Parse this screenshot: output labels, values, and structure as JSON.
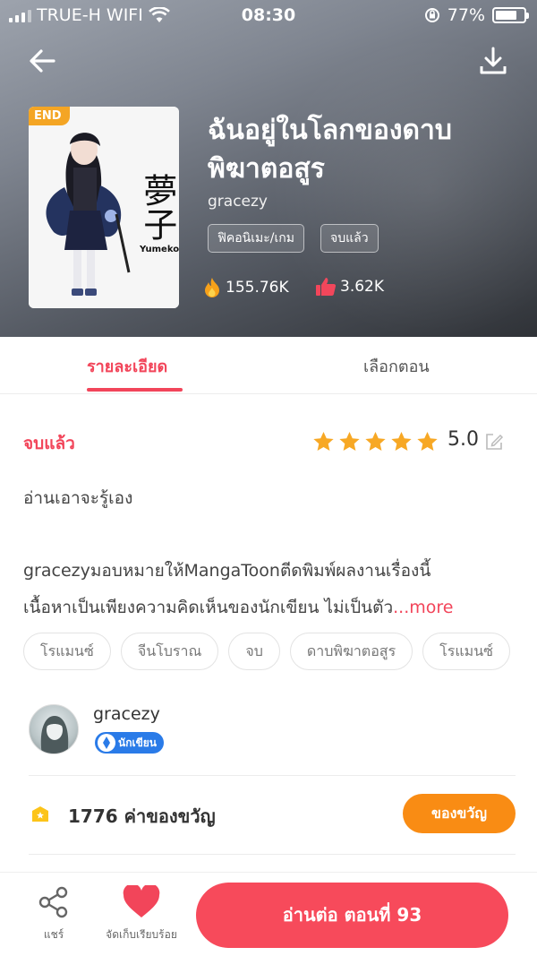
{
  "status_bar": {
    "carrier": "TRUE-H WIFI",
    "time": "08:30",
    "battery": "77%",
    "battery_level": 0.77
  },
  "header": {
    "end_badge": "END",
    "cover_kanji": "夢子",
    "cover_name": "Yumeko",
    "title_line1": "ฉันอยู่ในโลกของดาบ",
    "title_line2": "พิฆาตอสูร",
    "author": "gracezy",
    "tags": [
      "ฟิคอนิเมะ/เกม",
      "จบแล้ว"
    ],
    "views": "155.76K",
    "likes": "3.62K"
  },
  "tabs": {
    "details": "รายละเอียด",
    "episodes": "เลือกตอน"
  },
  "details": {
    "status": "จบแล้ว",
    "rating_value": "5.0",
    "rating_stars": 5,
    "summary": "อ่านเอาจะรู้เอง",
    "desc_line1": "gracezyมอบหมายให้MangaToonตีดพิมพ์ผลงานเรื่องนี้",
    "desc_line2": "เนื้อหาเป็นเพียงความคิดเห็นของนักเขียน ไม่เป็นตัว",
    "more": "...more",
    "tags": [
      "โรแมนซ์",
      "จีนโบราณ",
      "จบ",
      "ดาบพิฆาตอสูร",
      "โรแมนซ์"
    ]
  },
  "author_card": {
    "name": "gracezy",
    "badge": "นักเขียน"
  },
  "gift": {
    "text": "1776 ค่าของขวัญ",
    "button": "ของขวัญ"
  },
  "bottom_bar": {
    "share": "แชร์",
    "saved": "จัดเก็บเรียบร้อย",
    "read": "อ่านต่อ ตอนที่ 93"
  },
  "colors": {
    "accent": "#f2455a",
    "gift": "#f98c14",
    "star": "#f7a825",
    "badge": "#2a7be8"
  }
}
